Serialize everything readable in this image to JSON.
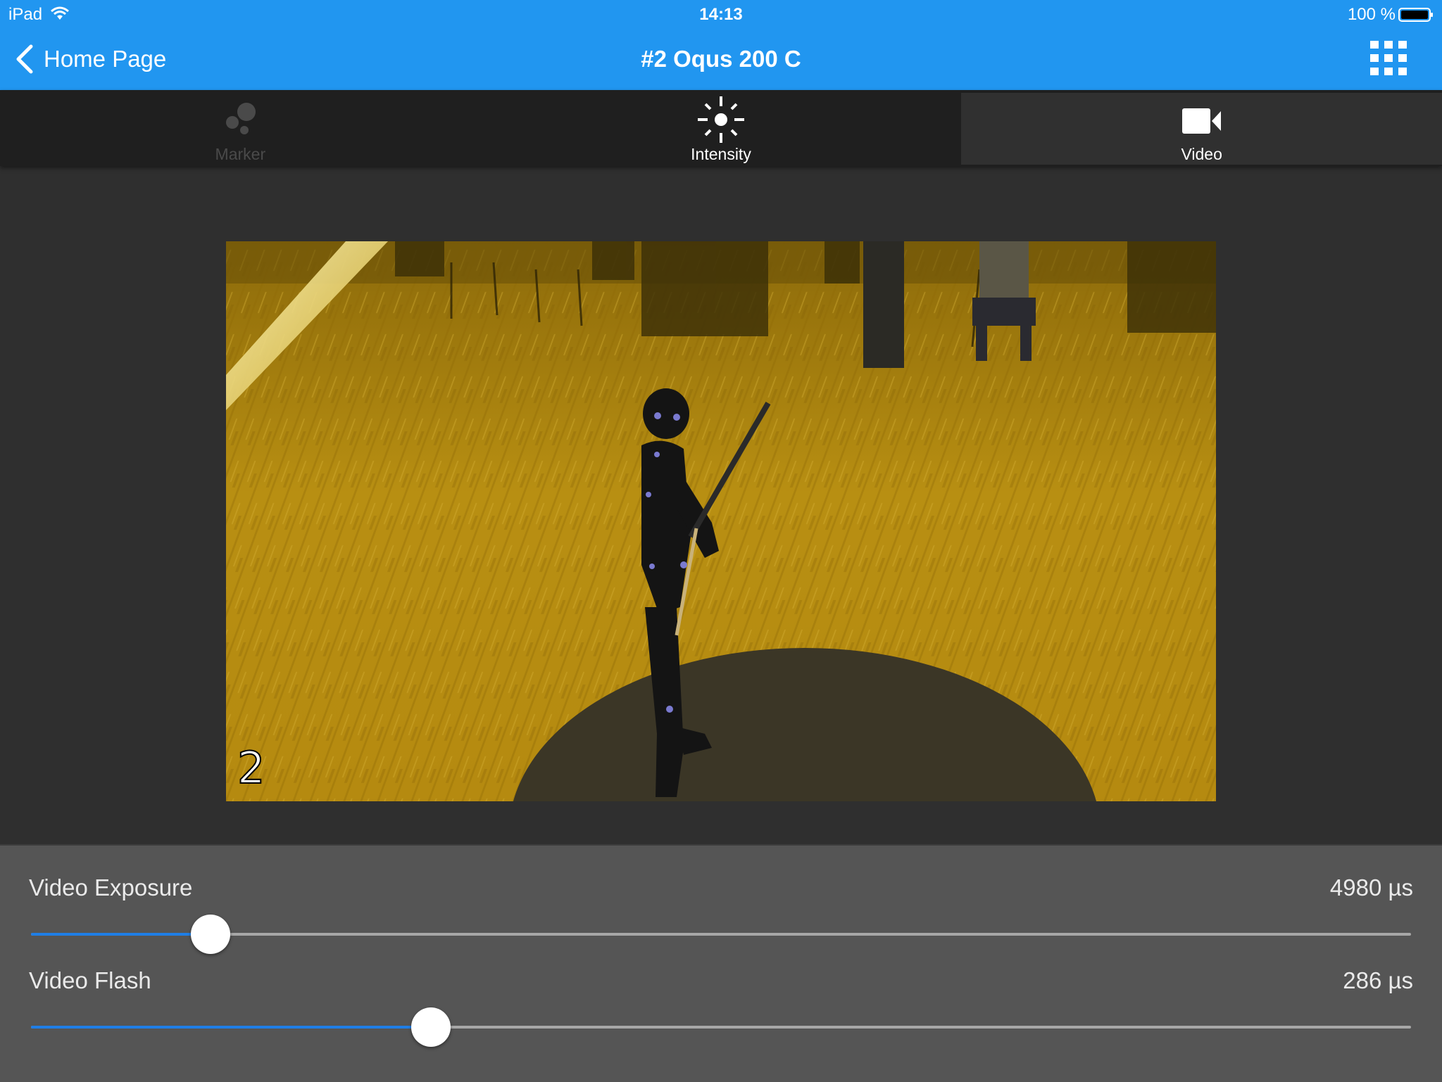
{
  "status_bar": {
    "device": "iPad",
    "time": "14:13",
    "battery": "100 %"
  },
  "nav": {
    "back_label": "Home Page",
    "title": "#2 Oqus 200 C"
  },
  "tabs": [
    {
      "label": "Marker",
      "icon": "marker-dots-icon",
      "state": "disabled"
    },
    {
      "label": "Intensity",
      "icon": "sun-icon",
      "state": "normal"
    },
    {
      "label": "Video",
      "icon": "video-camera-icon",
      "state": "selected"
    }
  ],
  "video": {
    "camera_number": "2"
  },
  "settings": {
    "exposure": {
      "label": "Video Exposure",
      "value": "4980 µs",
      "level": 0.13
    },
    "flash": {
      "label": "Video Flash",
      "value": "286 µs",
      "level": 0.29
    }
  },
  "colors": {
    "nav_bar": "#2196f0",
    "slider_fill": "#1f7ee6",
    "tab_bar": "#1f1f1f",
    "panel": "#555555"
  }
}
